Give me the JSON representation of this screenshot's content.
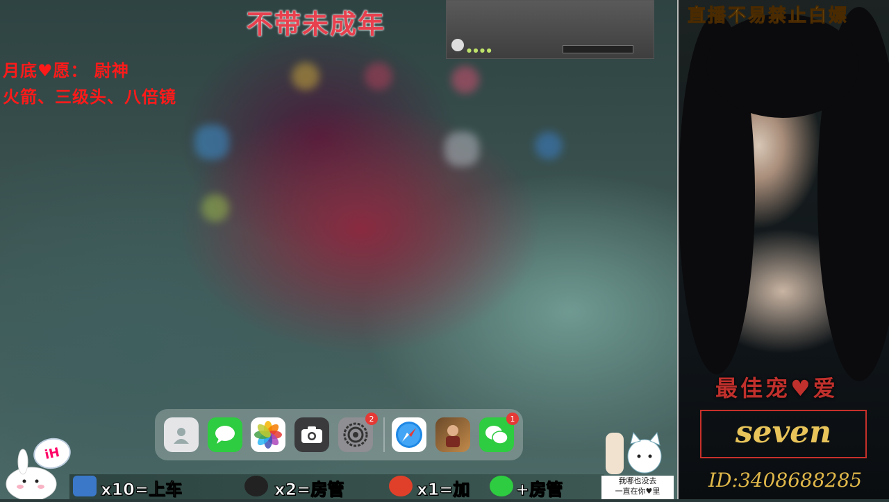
{
  "stream": {
    "title": "不带未成年",
    "wish_line1": "月底♥愿：  尉神",
    "wish_line2": "火箭、三级头、八倍镜"
  },
  "dock": {
    "apps": [
      {
        "name": "Contacts",
        "icon": "contacts-icon",
        "badge": ""
      },
      {
        "name": "Messages",
        "icon": "messages-icon",
        "badge": ""
      },
      {
        "name": "Photos",
        "icon": "photos-icon",
        "badge": ""
      },
      {
        "name": "Camera",
        "icon": "camera-icon",
        "badge": ""
      },
      {
        "name": "Settings",
        "icon": "settings-icon",
        "badge": "2"
      },
      {
        "name": "Safari",
        "icon": "safari-icon",
        "badge": ""
      },
      {
        "name": "Game",
        "icon": "game-icon",
        "badge": ""
      },
      {
        "name": "WeChat",
        "icon": "wechat-icon",
        "badge": "1"
      }
    ]
  },
  "bottom_bar": {
    "item1": "x10=上车",
    "item2": "x2=房管",
    "item3": "x1=加",
    "item4": "+房管"
  },
  "stickers": {
    "ih_label": "iH",
    "cat_note_line1": "我哪也没去",
    "cat_note_line2": "一直在你♥里"
  },
  "right_panel": {
    "top_text": "直播不易禁止白嫖",
    "best_pet_text": "最佳宠♥爱",
    "name": "seven",
    "id_text": "ID:3408688285"
  },
  "colors": {
    "title_red": "#e8404e",
    "overlay_red": "#ff1a1a",
    "gold": "#e8c45a",
    "badge_red": "#e53935"
  }
}
